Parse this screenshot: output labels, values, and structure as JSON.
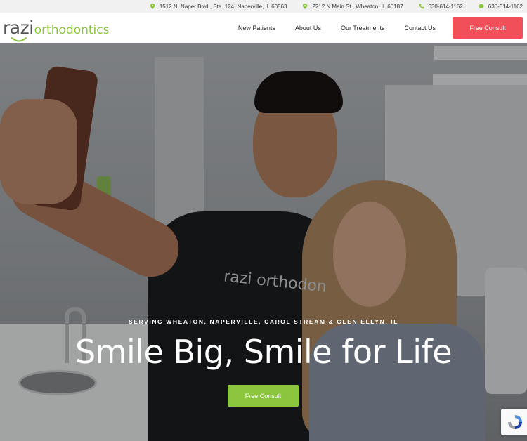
{
  "topbar": {
    "locations": [
      {
        "icon": "map-pin-icon",
        "text": "1512 N. Naper Blvd., Ste. 124, Naperville, IL 60563"
      },
      {
        "icon": "map-pin-icon",
        "text": "2212 N Main St., Wheaton, IL 60187"
      }
    ],
    "phone": {
      "icon": "phone-icon",
      "text": "630-614-1162"
    },
    "sms": {
      "icon": "chat-bubble-icon",
      "text": "630-614-1162"
    },
    "icon_color": "#8cc63f"
  },
  "header": {
    "logo": {
      "word1": "razi",
      "word2": "orthodontics"
    },
    "nav": [
      "New Patients",
      "About Us",
      "Our Treatments",
      "Contact Us"
    ],
    "cta": "Free Consult",
    "cta_color": "#f25058"
  },
  "hero": {
    "tagline": "SERVING WHEATON, NAPERVILLE, CAROL STREAM & GLEN ELLYN, IL",
    "headline": "Smile Big, Smile for Life",
    "cta": "Free Consult",
    "cta_color": "#8cc63f",
    "shirt_logo": "razi orthodon"
  }
}
